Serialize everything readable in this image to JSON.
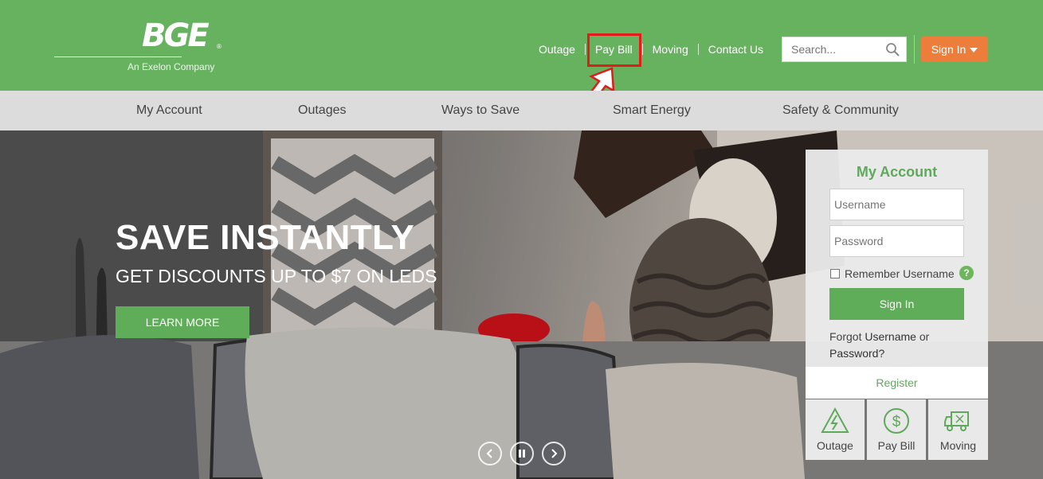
{
  "logo": {
    "text": "BGE",
    "tagline": "An Exelon Company"
  },
  "util_nav": {
    "outage": "Outage",
    "pay_bill": "Pay Bill",
    "moving": "Moving",
    "contact": "Contact Us"
  },
  "search": {
    "placeholder": "Search..."
  },
  "sign_in_label": "Sign In",
  "main_nav": [
    "My Account",
    "Outages",
    "Ways to Save",
    "Smart Energy",
    "Safety & Community"
  ],
  "hero": {
    "title": "SAVE INSTANTLY",
    "subtitle": "GET DISCOUNTS UP TO $7 ON LEDS",
    "cta": "LEARN MORE"
  },
  "login": {
    "title": "My Account",
    "username_placeholder": "Username",
    "password_placeholder": "Password",
    "remember_label": "Remember Username",
    "help": "?",
    "signin": "Sign In",
    "forgot_prefix": "Forgot",
    "forgot_username": "Username",
    "forgot_or": "or",
    "forgot_password": "Password?",
    "register": "Register"
  },
  "quick_links": [
    {
      "label": "Outage",
      "icon": "outage-warning-icon"
    },
    {
      "label": "Pay Bill",
      "icon": "dollar-icon"
    },
    {
      "label": "Moving",
      "icon": "truck-icon"
    }
  ],
  "carousel": {
    "prev": "prev-arrow-icon",
    "pause": "pause-icon",
    "next": "next-arrow-icon"
  },
  "colors": {
    "brand_green": "#66b25f",
    "accent_orange": "#ec7d3a",
    "nav_gray": "#dcdcdc",
    "highlight_red": "#e21b1b"
  }
}
